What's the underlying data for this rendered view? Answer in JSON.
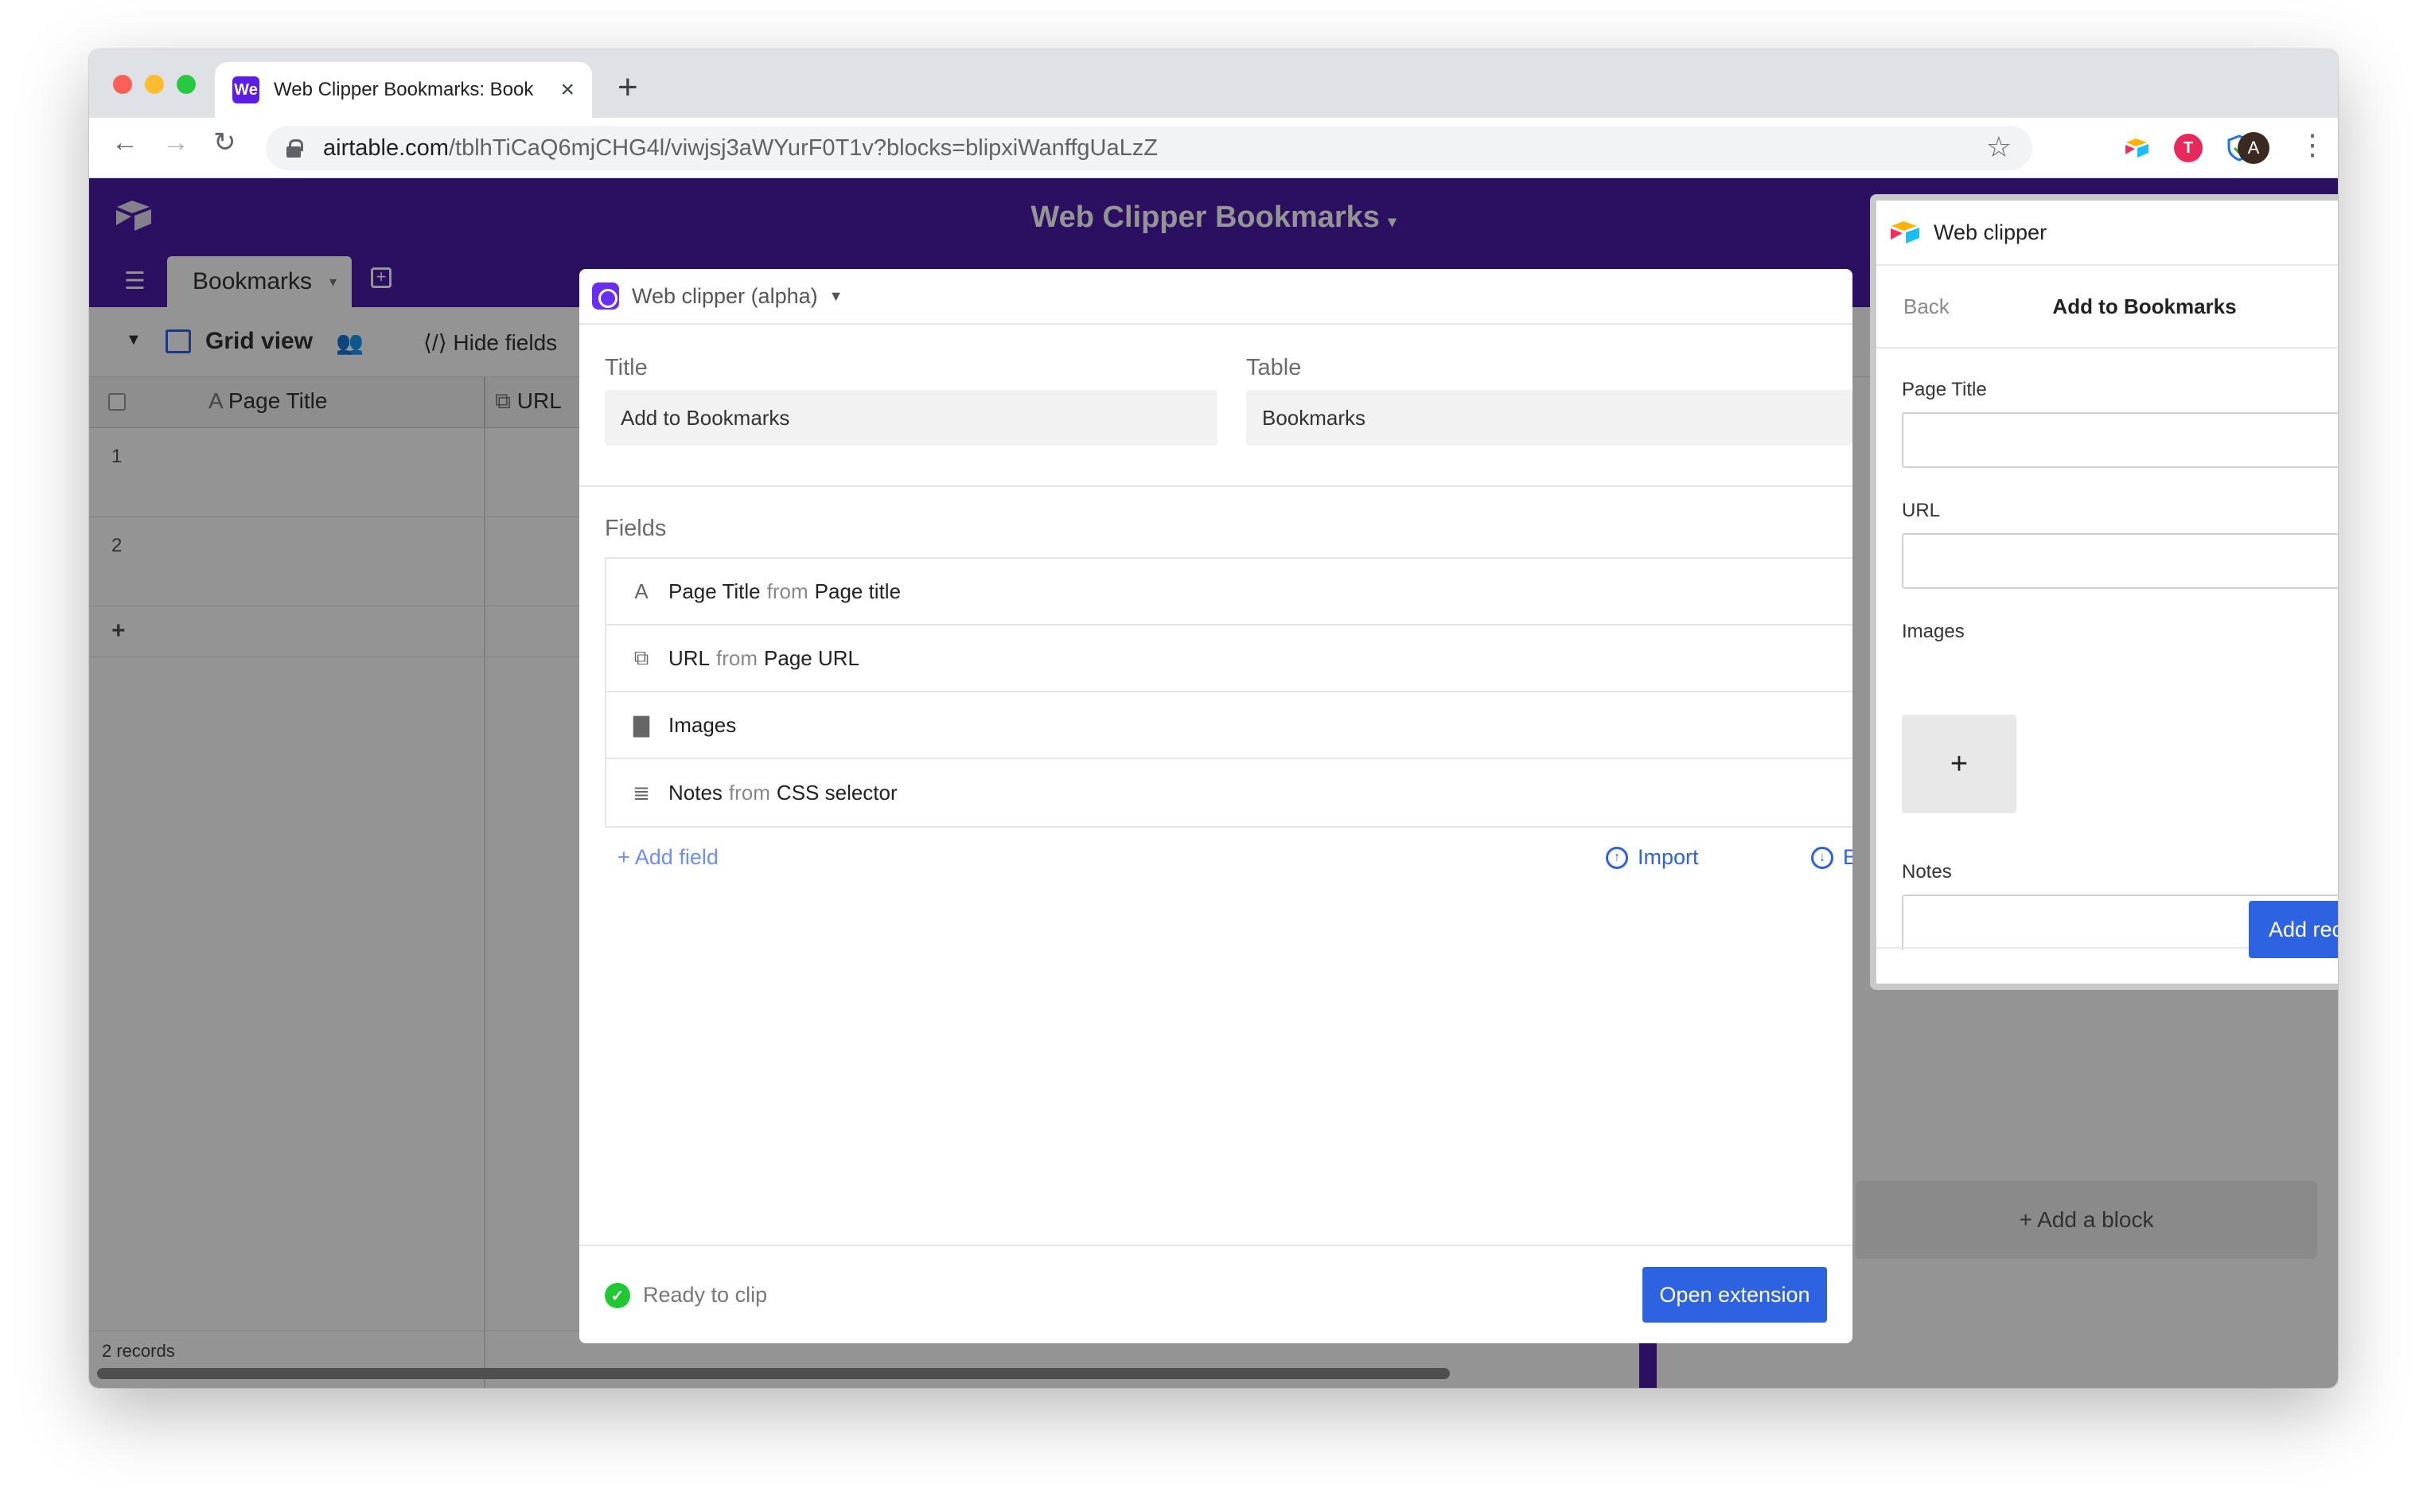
{
  "browser": {
    "tab_title": "Web Clipper Bookmarks: Book",
    "favicon_text": "We",
    "close_tab": "×",
    "new_tab": "+",
    "url_host": "airtable.com",
    "url_path": "/tblhTiCaQ6mjCHG4l/viwjsj3aWYurF0T1v?blocks=blipxiWanffgUaLzZ",
    "avatar_initial": "A",
    "ext_t": "T"
  },
  "base": {
    "title": "Web Clipper Bookmarks",
    "table_tab": "Bookmarks",
    "view_name": "Grid view",
    "hide_fields": "Hide fields",
    "col_page_title": "Page Title",
    "col_url": "URL",
    "row1": "1",
    "row2": "2",
    "add_row": "+",
    "record_count": "2 records",
    "add_block": "+ Add a block"
  },
  "clipper_modal": {
    "title": "Web clipper (alpha)",
    "title_label": "Title",
    "title_value": "Add to Bookmarks",
    "table_label": "Table",
    "table_value": "Bookmarks",
    "fields_label": "Fields",
    "fields": [
      {
        "name": "Page Title",
        "from": "from",
        "source": "Page title",
        "icon": "text-icon"
      },
      {
        "name": "URL",
        "from": "from",
        "source": "Page URL",
        "icon": "link-icon"
      },
      {
        "name": "Images",
        "from": "",
        "source": "",
        "icon": "attachment-icon"
      },
      {
        "name": "Notes",
        "from": "from",
        "source": "CSS selector",
        "icon": "long-text-icon"
      }
    ],
    "add_field": "+ Add field",
    "import": "Import",
    "export": "Exp",
    "status": "Ready to clip",
    "open_button": "Open extension"
  },
  "side_panel": {
    "title": "Web clipper",
    "back": "Back",
    "subtitle": "Add to Bookmarks",
    "more": "•••",
    "label_page_title": "Page Title",
    "label_url": "URL",
    "label_images": "Images",
    "label_notes": "Notes",
    "add_image": "+",
    "add_record": "Add record"
  },
  "colors": {
    "header_purple": "#4a1aa8",
    "primary_blue": "#2d62e0",
    "ready_green": "#20c933"
  }
}
